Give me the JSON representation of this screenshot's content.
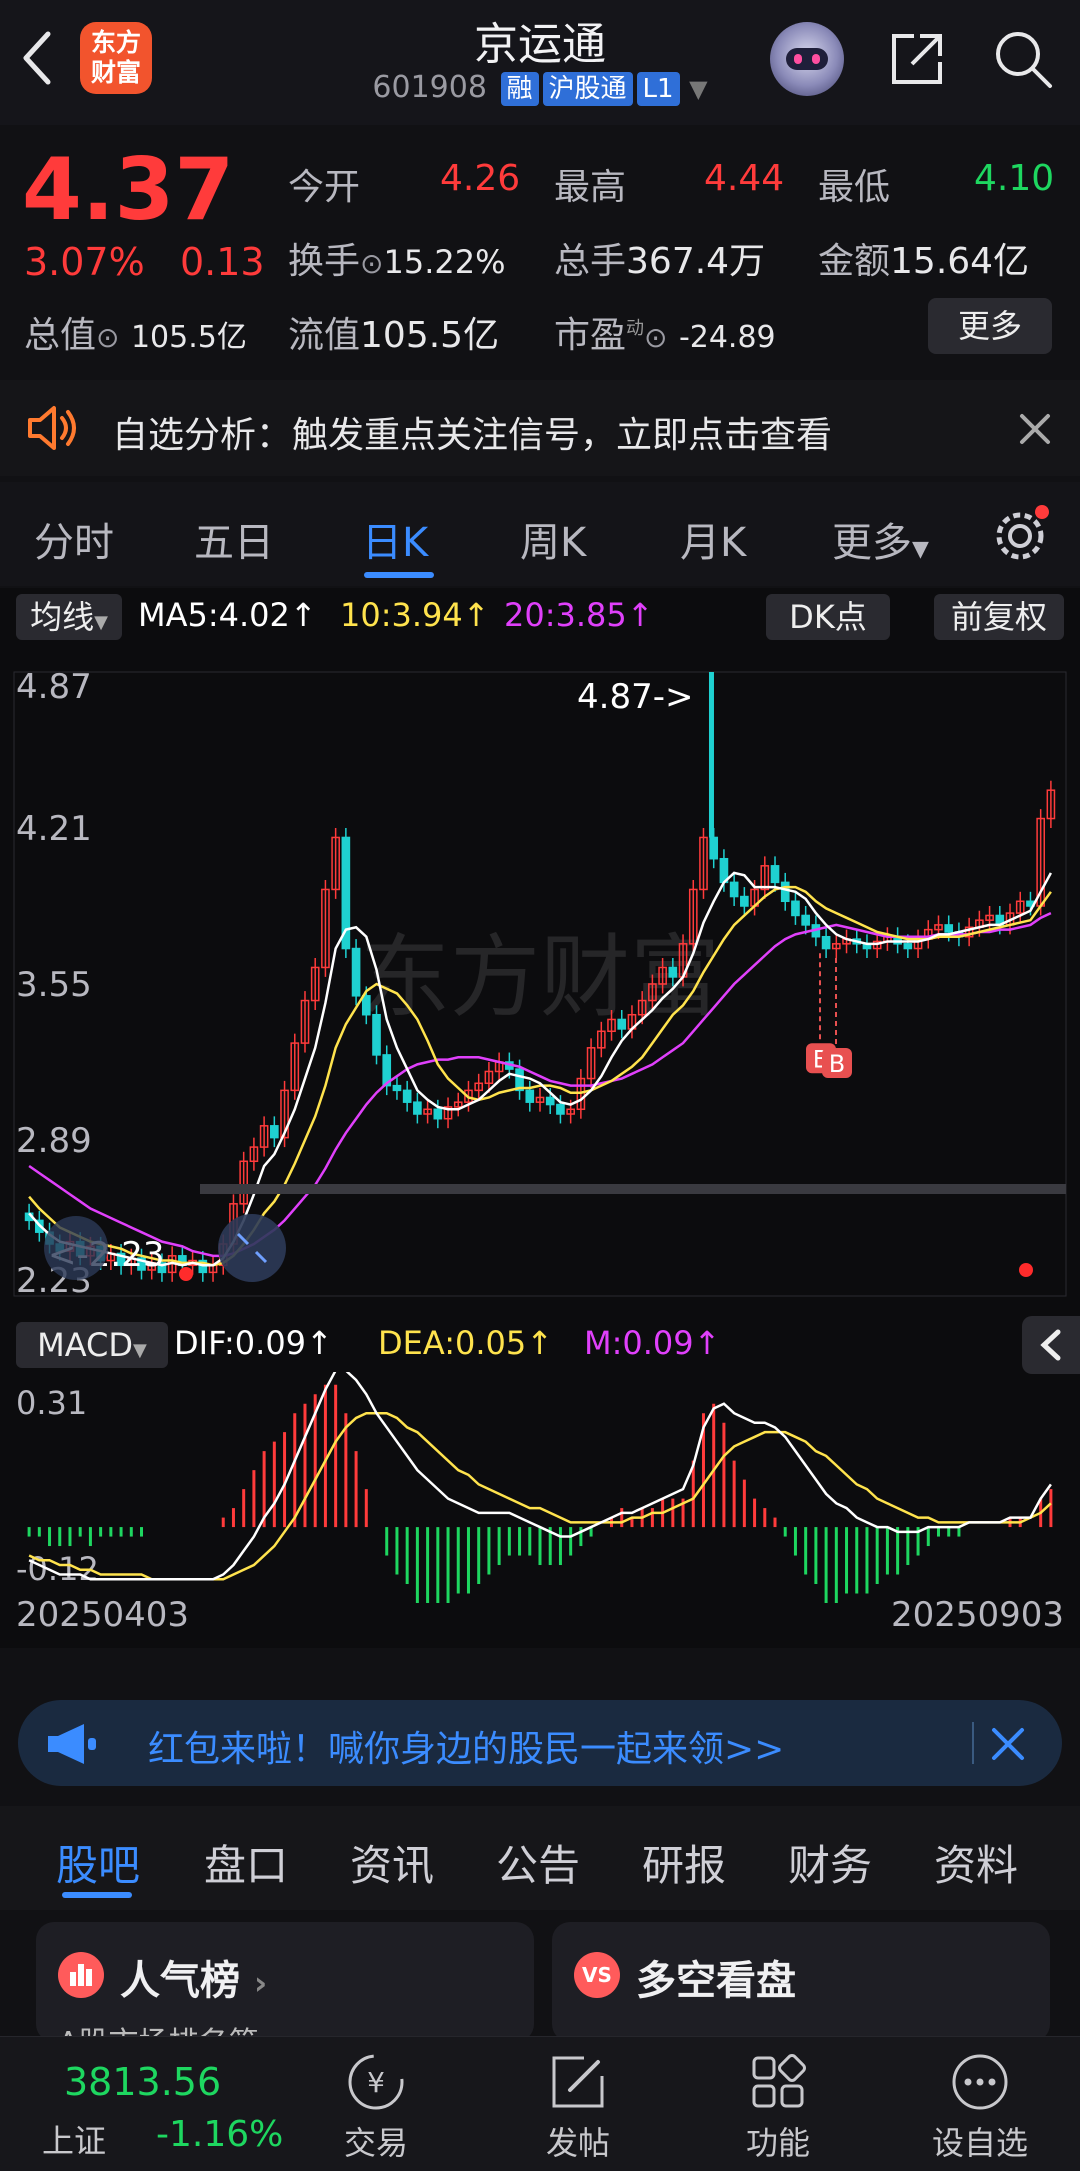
{
  "header": {
    "title": "京运通",
    "code": "601908",
    "tags": [
      "融",
      "沪股通",
      "L1"
    ],
    "logo_text": "东方财富"
  },
  "quote": {
    "price": "4.37",
    "change_pct": "3.07%",
    "change_amt": "0.13",
    "open_label": "今开",
    "open": "4.26",
    "high_label": "最高",
    "high": "4.44",
    "low_label": "最低",
    "low": "4.10",
    "turnover_label": "换手",
    "turnover": "15.22%",
    "volume_label": "总手",
    "volume": "367.4万",
    "amount_label": "金额",
    "amount": "15.64亿",
    "mktcap_label": "总值",
    "mktcap": "105.5亿",
    "float_label": "流值",
    "float": "105.5亿",
    "pe_label": "市盈",
    "pe_sup": "动",
    "pe": "-24.89",
    "more_label": "更多"
  },
  "notice": {
    "text": "自选分析：触发重点关注信号，立即点击查看"
  },
  "tabs": [
    "分时",
    "五日",
    "日K",
    "周K",
    "月K",
    "更多"
  ],
  "active_tab": 2,
  "indicator_bar": {
    "ma_button": "均线",
    "ma5": "MA5:4.02",
    "ma10": "10:3.94",
    "ma20": "20:3.85",
    "dk_button": "DK点",
    "adj_button": "前复权"
  },
  "macd_bar": {
    "button": "MACD",
    "dif": "DIF:0.09",
    "dea": "DEA:0.05",
    "m": "M:0.09"
  },
  "chart_data": [
    {
      "type": "candlestick",
      "title": "",
      "y_ticks": [
        "4.87",
        "4.21",
        "3.55",
        "2.89",
        "2.23"
      ],
      "ylim": [
        2.23,
        4.87
      ],
      "annotations": [
        "4.87->",
        "<-2.23",
        "B",
        "B"
      ],
      "x_start": "20250403",
      "x_end": "20250903",
      "close": [
        2.55,
        2.5,
        2.45,
        2.42,
        2.46,
        2.4,
        2.44,
        2.38,
        2.41,
        2.36,
        2.39,
        2.34,
        2.37,
        2.33,
        2.4,
        2.36,
        2.38,
        2.33,
        2.36,
        2.45,
        2.62,
        2.8,
        2.86,
        2.95,
        2.9,
        3.1,
        3.3,
        3.48,
        3.62,
        3.95,
        4.17,
        3.7,
        3.5,
        3.42,
        3.25,
        3.12,
        3.1,
        3.05,
        3.0,
        3.02,
        2.98,
        3.03,
        3.05,
        3.1,
        3.13,
        3.18,
        3.22,
        3.19,
        3.1,
        3.05,
        3.07,
        3.04,
        3.0,
        3.02,
        3.15,
        3.28,
        3.35,
        3.4,
        3.36,
        3.42,
        3.48,
        3.55,
        3.62,
        3.58,
        3.72,
        3.95,
        4.17,
        4.08,
        3.98,
        3.92,
        3.88,
        3.95,
        4.05,
        3.98,
        3.9,
        3.84,
        3.8,
        3.75,
        3.7,
        3.72,
        3.74,
        3.72,
        3.7,
        3.73,
        3.75,
        3.72,
        3.7,
        3.74,
        3.78,
        3.8,
        3.77,
        3.75,
        3.79,
        3.82,
        3.84,
        3.8,
        3.85,
        3.9,
        3.88,
        4.25,
        4.37
      ],
      "ma5": [
        2.58,
        2.53,
        2.49,
        2.46,
        2.45,
        2.44,
        2.43,
        2.42,
        2.41,
        2.4,
        2.39,
        2.38,
        2.37,
        2.36,
        2.37,
        2.36,
        2.37,
        2.36,
        2.36,
        2.39,
        2.46,
        2.55,
        2.66,
        2.78,
        2.83,
        2.92,
        3.02,
        3.15,
        3.28,
        3.47,
        3.7,
        3.78,
        3.79,
        3.75,
        3.61,
        3.4,
        3.28,
        3.19,
        3.1,
        3.06,
        3.03,
        3.02,
        3.02,
        3.04,
        3.06,
        3.1,
        3.14,
        3.17,
        3.16,
        3.15,
        3.13,
        3.09,
        3.05,
        3.04,
        3.06,
        3.1,
        3.16,
        3.24,
        3.31,
        3.36,
        3.4,
        3.44,
        3.49,
        3.53,
        3.58,
        3.68,
        3.81,
        3.9,
        3.98,
        4.02,
        4.01,
        3.96,
        3.96,
        3.96,
        3.95,
        3.94,
        3.91,
        3.85,
        3.8,
        3.76,
        3.74,
        3.73,
        3.72,
        3.72,
        3.73,
        3.73,
        3.73,
        3.73,
        3.74,
        3.76,
        3.76,
        3.77,
        3.78,
        3.79,
        3.8,
        3.8,
        3.82,
        3.84,
        3.86,
        3.94,
        4.02
      ],
      "ma10": [
        2.65,
        2.6,
        2.56,
        2.52,
        2.5,
        2.48,
        2.46,
        2.45,
        2.44,
        2.43,
        2.41,
        2.4,
        2.39,
        2.38,
        2.38,
        2.37,
        2.37,
        2.37,
        2.36,
        2.37,
        2.4,
        2.45,
        2.51,
        2.58,
        2.63,
        2.7,
        2.79,
        2.89,
        2.99,
        3.12,
        3.28,
        3.38,
        3.45,
        3.52,
        3.55,
        3.53,
        3.51,
        3.46,
        3.4,
        3.31,
        3.21,
        3.15,
        3.11,
        3.07,
        3.06,
        3.07,
        3.09,
        3.1,
        3.11,
        3.11,
        3.12,
        3.12,
        3.11,
        3.09,
        3.09,
        3.1,
        3.12,
        3.14,
        3.17,
        3.2,
        3.24,
        3.3,
        3.36,
        3.42,
        3.46,
        3.52,
        3.6,
        3.67,
        3.74,
        3.8,
        3.84,
        3.88,
        3.92,
        3.95,
        3.96,
        3.96,
        3.94,
        3.9,
        3.87,
        3.85,
        3.83,
        3.81,
        3.79,
        3.77,
        3.76,
        3.75,
        3.74,
        3.74,
        3.74,
        3.75,
        3.75,
        3.75,
        3.76,
        3.77,
        3.78,
        3.79,
        3.8,
        3.81,
        3.82,
        3.88,
        3.94
      ],
      "ma20": [
        2.78,
        2.75,
        2.72,
        2.69,
        2.66,
        2.63,
        2.6,
        2.58,
        2.56,
        2.54,
        2.52,
        2.5,
        2.48,
        2.46,
        2.45,
        2.44,
        2.42,
        2.41,
        2.4,
        2.4,
        2.41,
        2.43,
        2.45,
        2.48,
        2.51,
        2.55,
        2.6,
        2.65,
        2.7,
        2.77,
        2.85,
        2.92,
        2.98,
        3.04,
        3.09,
        3.13,
        3.16,
        3.19,
        3.21,
        3.22,
        3.23,
        3.23,
        3.24,
        3.24,
        3.24,
        3.23,
        3.22,
        3.21,
        3.2,
        3.18,
        3.16,
        3.14,
        3.13,
        3.12,
        3.12,
        3.12,
        3.13,
        3.14,
        3.15,
        3.17,
        3.19,
        3.21,
        3.24,
        3.27,
        3.3,
        3.35,
        3.4,
        3.45,
        3.5,
        3.55,
        3.59,
        3.63,
        3.67,
        3.71,
        3.74,
        3.76,
        3.77,
        3.78,
        3.79,
        3.8,
        3.79,
        3.78,
        3.77,
        3.76,
        3.75,
        3.75,
        3.75,
        3.75,
        3.75,
        3.76,
        3.76,
        3.76,
        3.76,
        3.77,
        3.77,
        3.78,
        3.78,
        3.79,
        3.8,
        3.83,
        3.85
      ]
    },
    {
      "type": "macd",
      "title": "",
      "y_ticks": [
        "0.31",
        "-0.12"
      ],
      "ylim": [
        -0.12,
        0.31
      ],
      "x_start": "20250403",
      "x_end": "20250903",
      "dif": [
        -0.07,
        -0.08,
        -0.09,
        -0.1,
        -0.1,
        -0.1,
        -0.11,
        -0.11,
        -0.11,
        -0.11,
        -0.11,
        -0.11,
        -0.11,
        -0.11,
        -0.11,
        -0.11,
        -0.11,
        -0.11,
        -0.11,
        -0.1,
        -0.08,
        -0.05,
        -0.02,
        0.02,
        0.05,
        0.09,
        0.14,
        0.19,
        0.24,
        0.29,
        0.33,
        0.33,
        0.31,
        0.28,
        0.24,
        0.21,
        0.18,
        0.15,
        0.12,
        0.1,
        0.08,
        0.06,
        0.05,
        0.04,
        0.03,
        0.03,
        0.03,
        0.03,
        0.02,
        0.01,
        0.0,
        -0.01,
        -0.02,
        -0.02,
        -0.01,
        0.0,
        0.01,
        0.02,
        0.03,
        0.03,
        0.04,
        0.05,
        0.06,
        0.07,
        0.08,
        0.13,
        0.21,
        0.25,
        0.26,
        0.24,
        0.23,
        0.22,
        0.22,
        0.21,
        0.19,
        0.16,
        0.13,
        0.1,
        0.07,
        0.05,
        0.04,
        0.02,
        0.01,
        0.0,
        0.0,
        -0.01,
        -0.01,
        -0.01,
        0.0,
        0.0,
        0.0,
        0.0,
        0.01,
        0.01,
        0.01,
        0.01,
        0.02,
        0.02,
        0.02,
        0.06,
        0.09
      ],
      "dea": [
        -0.06,
        -0.07,
        -0.07,
        -0.08,
        -0.08,
        -0.09,
        -0.09,
        -0.1,
        -0.1,
        -0.1,
        -0.1,
        -0.1,
        -0.11,
        -0.11,
        -0.11,
        -0.11,
        -0.11,
        -0.11,
        -0.11,
        -0.11,
        -0.1,
        -0.09,
        -0.08,
        -0.06,
        -0.04,
        -0.01,
        0.02,
        0.06,
        0.1,
        0.14,
        0.18,
        0.21,
        0.23,
        0.24,
        0.24,
        0.24,
        0.23,
        0.21,
        0.2,
        0.18,
        0.16,
        0.14,
        0.12,
        0.11,
        0.09,
        0.08,
        0.07,
        0.06,
        0.05,
        0.04,
        0.04,
        0.03,
        0.02,
        0.01,
        0.01,
        0.01,
        0.01,
        0.01,
        0.01,
        0.02,
        0.02,
        0.03,
        0.03,
        0.04,
        0.05,
        0.06,
        0.09,
        0.12,
        0.15,
        0.17,
        0.18,
        0.19,
        0.2,
        0.2,
        0.2,
        0.19,
        0.18,
        0.16,
        0.15,
        0.13,
        0.11,
        0.09,
        0.08,
        0.06,
        0.05,
        0.04,
        0.03,
        0.02,
        0.02,
        0.01,
        0.01,
        0.01,
        0.01,
        0.01,
        0.01,
        0.01,
        0.01,
        0.01,
        0.02,
        0.03,
        0.05
      ]
    }
  ],
  "banner": {
    "text": "红包来啦！喊你身边的股民一起来领>>"
  },
  "bottom_tabs": [
    "股吧",
    "盘口",
    "资讯",
    "公告",
    "研报",
    "财务",
    "资料"
  ],
  "cards": {
    "left_title": "人气榜",
    "left_sub": "A股市场排名第",
    "right_title": "多空看盘",
    "right_badge": "VS"
  },
  "footer": {
    "index_value": "3813.56",
    "index_name": "上证",
    "index_change": "-1.16%",
    "items": [
      "交易",
      "发帖",
      "功能",
      "设自选"
    ]
  },
  "colors": {
    "up": "#ff3b3b",
    "down": "#1ed760",
    "accent": "#3b8cff",
    "ma5": "#ffffff",
    "ma10": "#ffe34d",
    "ma20": "#e040fb"
  }
}
